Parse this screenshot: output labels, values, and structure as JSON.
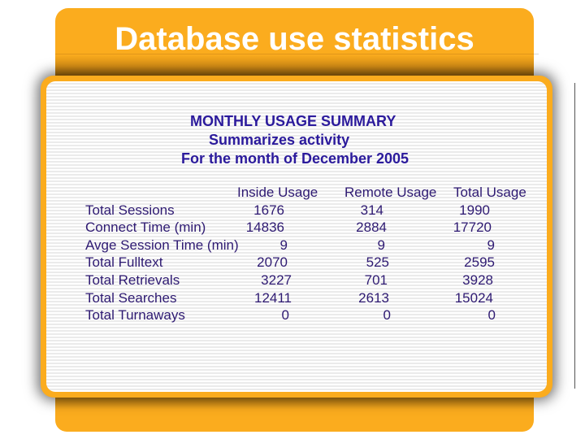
{
  "slide": {
    "title": "Database use statistics"
  },
  "report": {
    "heading": "MONTHLY USAGE SUMMARY",
    "subheading": "Summarizes activity",
    "period": "For the month of December 2005"
  },
  "table": {
    "columns": [
      "Inside Usage",
      "Remote Usage",
      "Total Usage"
    ],
    "rows": [
      {
        "label": "Total Sessions",
        "inside": "1676",
        "remote": "314",
        "total": "1990"
      },
      {
        "label": "Connect Time (min)",
        "inside": "14836",
        "remote": "2884",
        "total": "17720"
      },
      {
        "label": "Avge Session Time (min)",
        "inside": "9",
        "remote": "9",
        "total": "9"
      },
      {
        "label": "Total Fulltext",
        "inside": "2070",
        "remote": "525",
        "total": "2595"
      },
      {
        "label": "Total Retrievals",
        "inside": "3227",
        "remote": "701",
        "total": "3928"
      },
      {
        "label": "Total Searches",
        "inside": "12411",
        "remote": "2613",
        "total": "15024"
      },
      {
        "label": "Total Turnaways",
        "inside": "0",
        "remote": "0",
        "total": "0"
      }
    ]
  },
  "colors": {
    "accent_orange": "#fbac1e",
    "heading_text": "#2b1a9c",
    "table_text": "#2e1a72"
  }
}
